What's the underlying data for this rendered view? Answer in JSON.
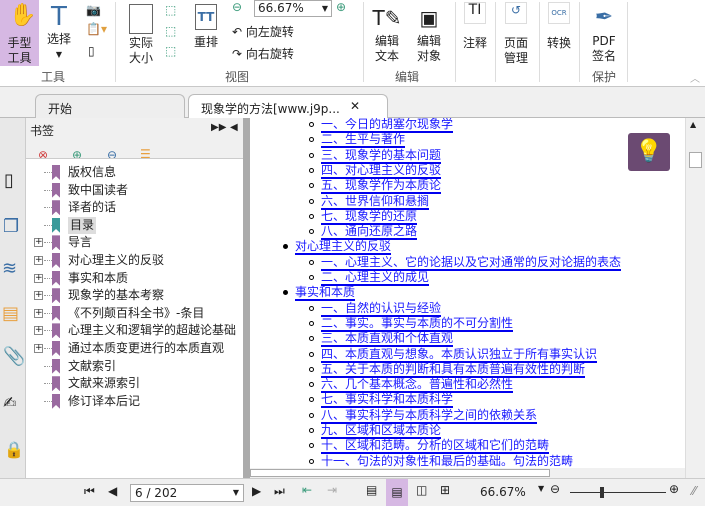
{
  "ribbon": {
    "hand_tool": "手型\n工具",
    "select": "选择",
    "actual_size": "实际\n大小",
    "reflow": "重排",
    "zoom_value": "66.67%",
    "rotate_left": "向左旋转",
    "rotate_right": "向右旋转",
    "edit_text": "编辑\n文本",
    "edit_object": "编辑\n对象",
    "comment": "注释",
    "page_manage": "页面\n管理",
    "convert": "转换",
    "pdf_sign": "PDF\n签名",
    "groups": {
      "tools": "工具",
      "view": "视图",
      "edit": "编辑",
      "protect": "保护"
    }
  },
  "tabs": [
    {
      "label": "开始"
    },
    {
      "label": "现象学的方法[www.j9p..."
    }
  ],
  "bookmarks": {
    "title": "书签",
    "items": [
      {
        "label": "版权信息",
        "expandable": false
      },
      {
        "label": "致中国读者",
        "expandable": false
      },
      {
        "label": "译者的话",
        "expandable": false
      },
      {
        "label": "目录",
        "expandable": false,
        "selected": true
      },
      {
        "label": "导言",
        "expandable": true
      },
      {
        "label": "对心理主义的反驳",
        "expandable": true
      },
      {
        "label": "事实和本质",
        "expandable": true
      },
      {
        "label": "现象学的基本考察",
        "expandable": true
      },
      {
        "label": "《不列颠百科全书》-条目",
        "expandable": true
      },
      {
        "label": "心理主义和逻辑学的超越论基础",
        "expandable": true
      },
      {
        "label": "通过本质变更进行的本质直观",
        "expandable": true
      },
      {
        "label": "文献索引",
        "expandable": false
      },
      {
        "label": "文献来源索引",
        "expandable": false
      },
      {
        "label": "修订译本后记",
        "expandable": false
      }
    ]
  },
  "document": {
    "lines": [
      {
        "level": 2,
        "text": "一、今日的胡塞尔现象学"
      },
      {
        "level": 2,
        "text": "二、生平与著作"
      },
      {
        "level": 2,
        "text": "三、现象学的基本问题"
      },
      {
        "level": 2,
        "text": "四、对心理主义的反驳"
      },
      {
        "level": 2,
        "text": "五、现象学作为本质论"
      },
      {
        "level": 2,
        "text": "六、世界信仰和悬搁"
      },
      {
        "level": 2,
        "text": "七、现象学的还原"
      },
      {
        "level": 2,
        "text": "八、通向还原之路"
      },
      {
        "level": 1,
        "text": "对心理主义的反驳"
      },
      {
        "level": 2,
        "text": "一、心理主义、它的论据以及它对通常的反对论据的表态"
      },
      {
        "level": 2,
        "text": "二、心理主义的成见"
      },
      {
        "level": 1,
        "text": "事实和本质"
      },
      {
        "level": 2,
        "text": "一、自然的认识与经验"
      },
      {
        "level": 2,
        "text": "二、事实。事实与本质的不可分割性"
      },
      {
        "level": 2,
        "text": "三、本质直观和个体直观"
      },
      {
        "level": 2,
        "text": "四、本质直观与想象。本质认识独立于所有事实认识"
      },
      {
        "level": 2,
        "text": "五、关于本质的判断和具有本质普遍有效性的判断"
      },
      {
        "level": 2,
        "text": "六、几个基本概念。普遍性和必然性"
      },
      {
        "level": 2,
        "text": "七、事实科学和本质科学"
      },
      {
        "level": 2,
        "text": "八、事实科学与本质科学之间的依赖关系"
      },
      {
        "level": 2,
        "text": "九、区域和区域本质论"
      },
      {
        "level": 2,
        "text": "十、区域和范畴。分析的区域和它们的范畴"
      },
      {
        "level": 2,
        "text": "十一、句法的对象性和最后的基础。句法的范畴"
      }
    ]
  },
  "status": {
    "page": "6 / 202",
    "zoom": "66.67%"
  },
  "colors": {
    "accent": "#d6b8e3",
    "link": "#0000ee",
    "bookmark": "#9a6aa0"
  }
}
